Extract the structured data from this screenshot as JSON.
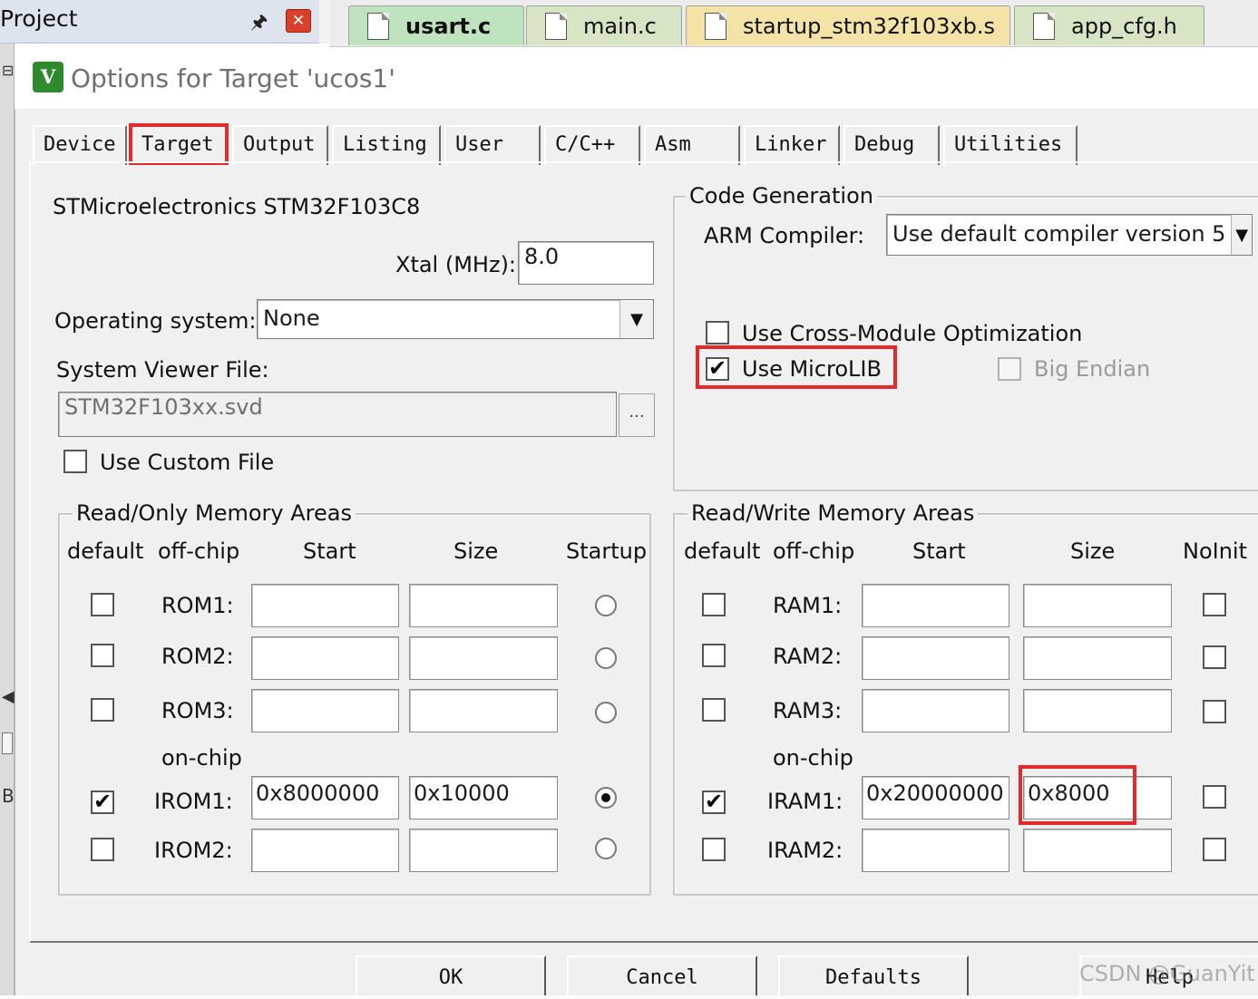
{
  "ide": {
    "project_title": "Project",
    "pin_icon": "pin-icon",
    "close_icon": "close-icon",
    "file_tabs": [
      "usart.c",
      "main.c",
      "startup_stm32f103xb.s",
      "app_cfg.h"
    ],
    "active_file_tab": "usart.c",
    "edge_fragment": "Bu"
  },
  "dialog": {
    "title": "Options for Target 'ucos1'",
    "app_icon": "keil-uvision-icon",
    "app_icon_text": "V",
    "tabs": [
      "Device",
      "Target",
      "Output",
      "Listing",
      "User",
      "C/C++",
      "Asm",
      "Linker",
      "Debug",
      "Utilities"
    ],
    "active_tab": "Target"
  },
  "target": {
    "device_name": "STMicroelectronics STM32F103C8",
    "xtal_label": "Xtal (MHz):",
    "xtal_value": "8.0",
    "os_label": "Operating system:",
    "os_value": "None",
    "svf_label": "System Viewer File:",
    "svf_value": "STM32F103xx.svd",
    "svf_browse": "...",
    "custom_file_label": "Use Custom File",
    "custom_file_checked": false
  },
  "code_gen": {
    "legend": "Code Generation",
    "compiler_label": "ARM Compiler:",
    "compiler_value": "Use default compiler version 5",
    "cross_module_label": "Use Cross-Module Optimization",
    "cross_module_checked": false,
    "microlib_label": "Use MicroLIB",
    "microlib_checked": true,
    "big_endian_label": "Big Endian",
    "big_endian_checked": false
  },
  "rom": {
    "legend": "Read/Only Memory Areas",
    "headers": [
      "default",
      "off-chip",
      "Start",
      "Size",
      "Startup"
    ],
    "on_chip_label": "on-chip",
    "rows": [
      {
        "label": "ROM1:",
        "default": false,
        "start": "",
        "size": "",
        "startup": false
      },
      {
        "label": "ROM2:",
        "default": false,
        "start": "",
        "size": "",
        "startup": false
      },
      {
        "label": "ROM3:",
        "default": false,
        "start": "",
        "size": "",
        "startup": false
      },
      {
        "label": "IROM1:",
        "default": true,
        "start": "0x8000000",
        "size": "0x10000",
        "startup": true
      },
      {
        "label": "IROM2:",
        "default": false,
        "start": "",
        "size": "",
        "startup": false
      }
    ]
  },
  "ram": {
    "legend": "Read/Write Memory Areas",
    "headers": [
      "default",
      "off-chip",
      "Start",
      "Size",
      "NoInit"
    ],
    "on_chip_label": "on-chip",
    "rows": [
      {
        "label": "RAM1:",
        "default": false,
        "start": "",
        "size": "",
        "noinit": false
      },
      {
        "label": "RAM2:",
        "default": false,
        "start": "",
        "size": "",
        "noinit": false
      },
      {
        "label": "RAM3:",
        "default": false,
        "start": "",
        "size": "",
        "noinit": false
      },
      {
        "label": "IRAM1:",
        "default": true,
        "start": "0x20000000",
        "size": "0x8000",
        "noinit": false
      },
      {
        "label": "IRAM2:",
        "default": false,
        "start": "",
        "size": "",
        "noinit": false
      }
    ]
  },
  "buttons": {
    "ok": "OK",
    "cancel": "Cancel",
    "defaults": "Defaults",
    "help": "Help"
  },
  "watermark": "CSDN @GuanYit",
  "colors": {
    "highlight": "#e32b2b",
    "dialog_bg": "#f0f0f0"
  }
}
